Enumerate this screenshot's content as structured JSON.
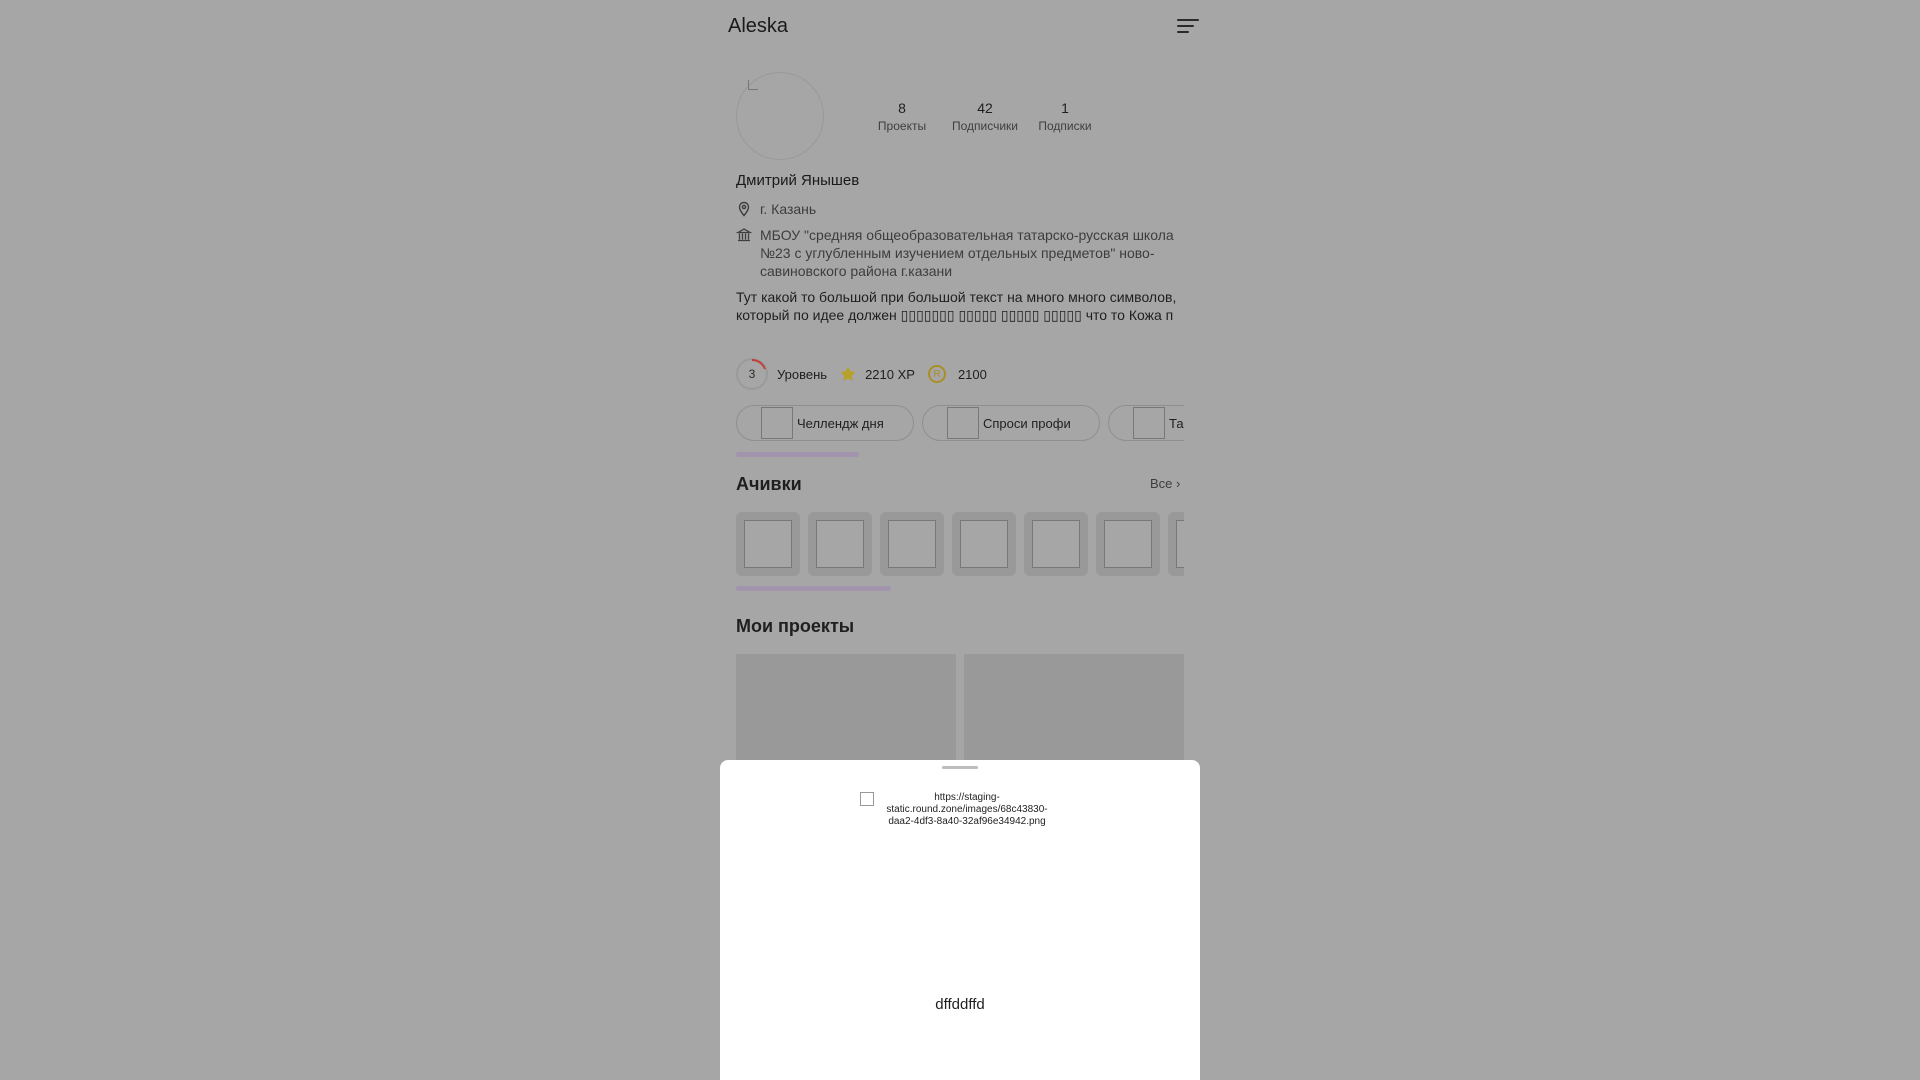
{
  "header": {
    "title": "Aleska",
    "menu_icon": "menu-icon"
  },
  "profile": {
    "stats": [
      {
        "value": "8",
        "label": "Проекты"
      },
      {
        "value": "42",
        "label": "Подписчики"
      },
      {
        "value": "1",
        "label": "Подписки"
      }
    ],
    "name": "Дмитрий Янышев",
    "city": "г. Казань",
    "school": "МБОУ \"средняя общеобразовательная татарско-русская школа №23 с углубленным изучением отдельных предметов\" ново-савиновского района г.казани",
    "bio": "Тут какой то большой при большой текст на много много символов, который по идее должен ▯▯▯▯▯▯▯ ▯▯▯▯▯ ▯▯▯▯▯ ▯▯▯▯▯ что то Кожа п"
  },
  "level": {
    "value": "3",
    "label": "Уровень",
    "xp": "2210 XP",
    "coin_symbol": "R",
    "coins": "2100"
  },
  "pills": [
    "Челлендж дня",
    "Спроси профи",
    "Та"
  ],
  "achievements": {
    "title": "Ачивки",
    "all_label": "Все ›",
    "count": 7
  },
  "projects": {
    "title": "Мои проекты"
  },
  "sheet": {
    "image_alt": "https://staging-static.round.zone/images/68c43830-daa2-4df3-8a40-32af96e34942.png",
    "text": "dffddffd"
  },
  "colors": {
    "overlay_bg": "#a6a6a6",
    "accent_scroll": "#a294ad",
    "coin": "#a88f26",
    "star": "#b8a12a"
  }
}
